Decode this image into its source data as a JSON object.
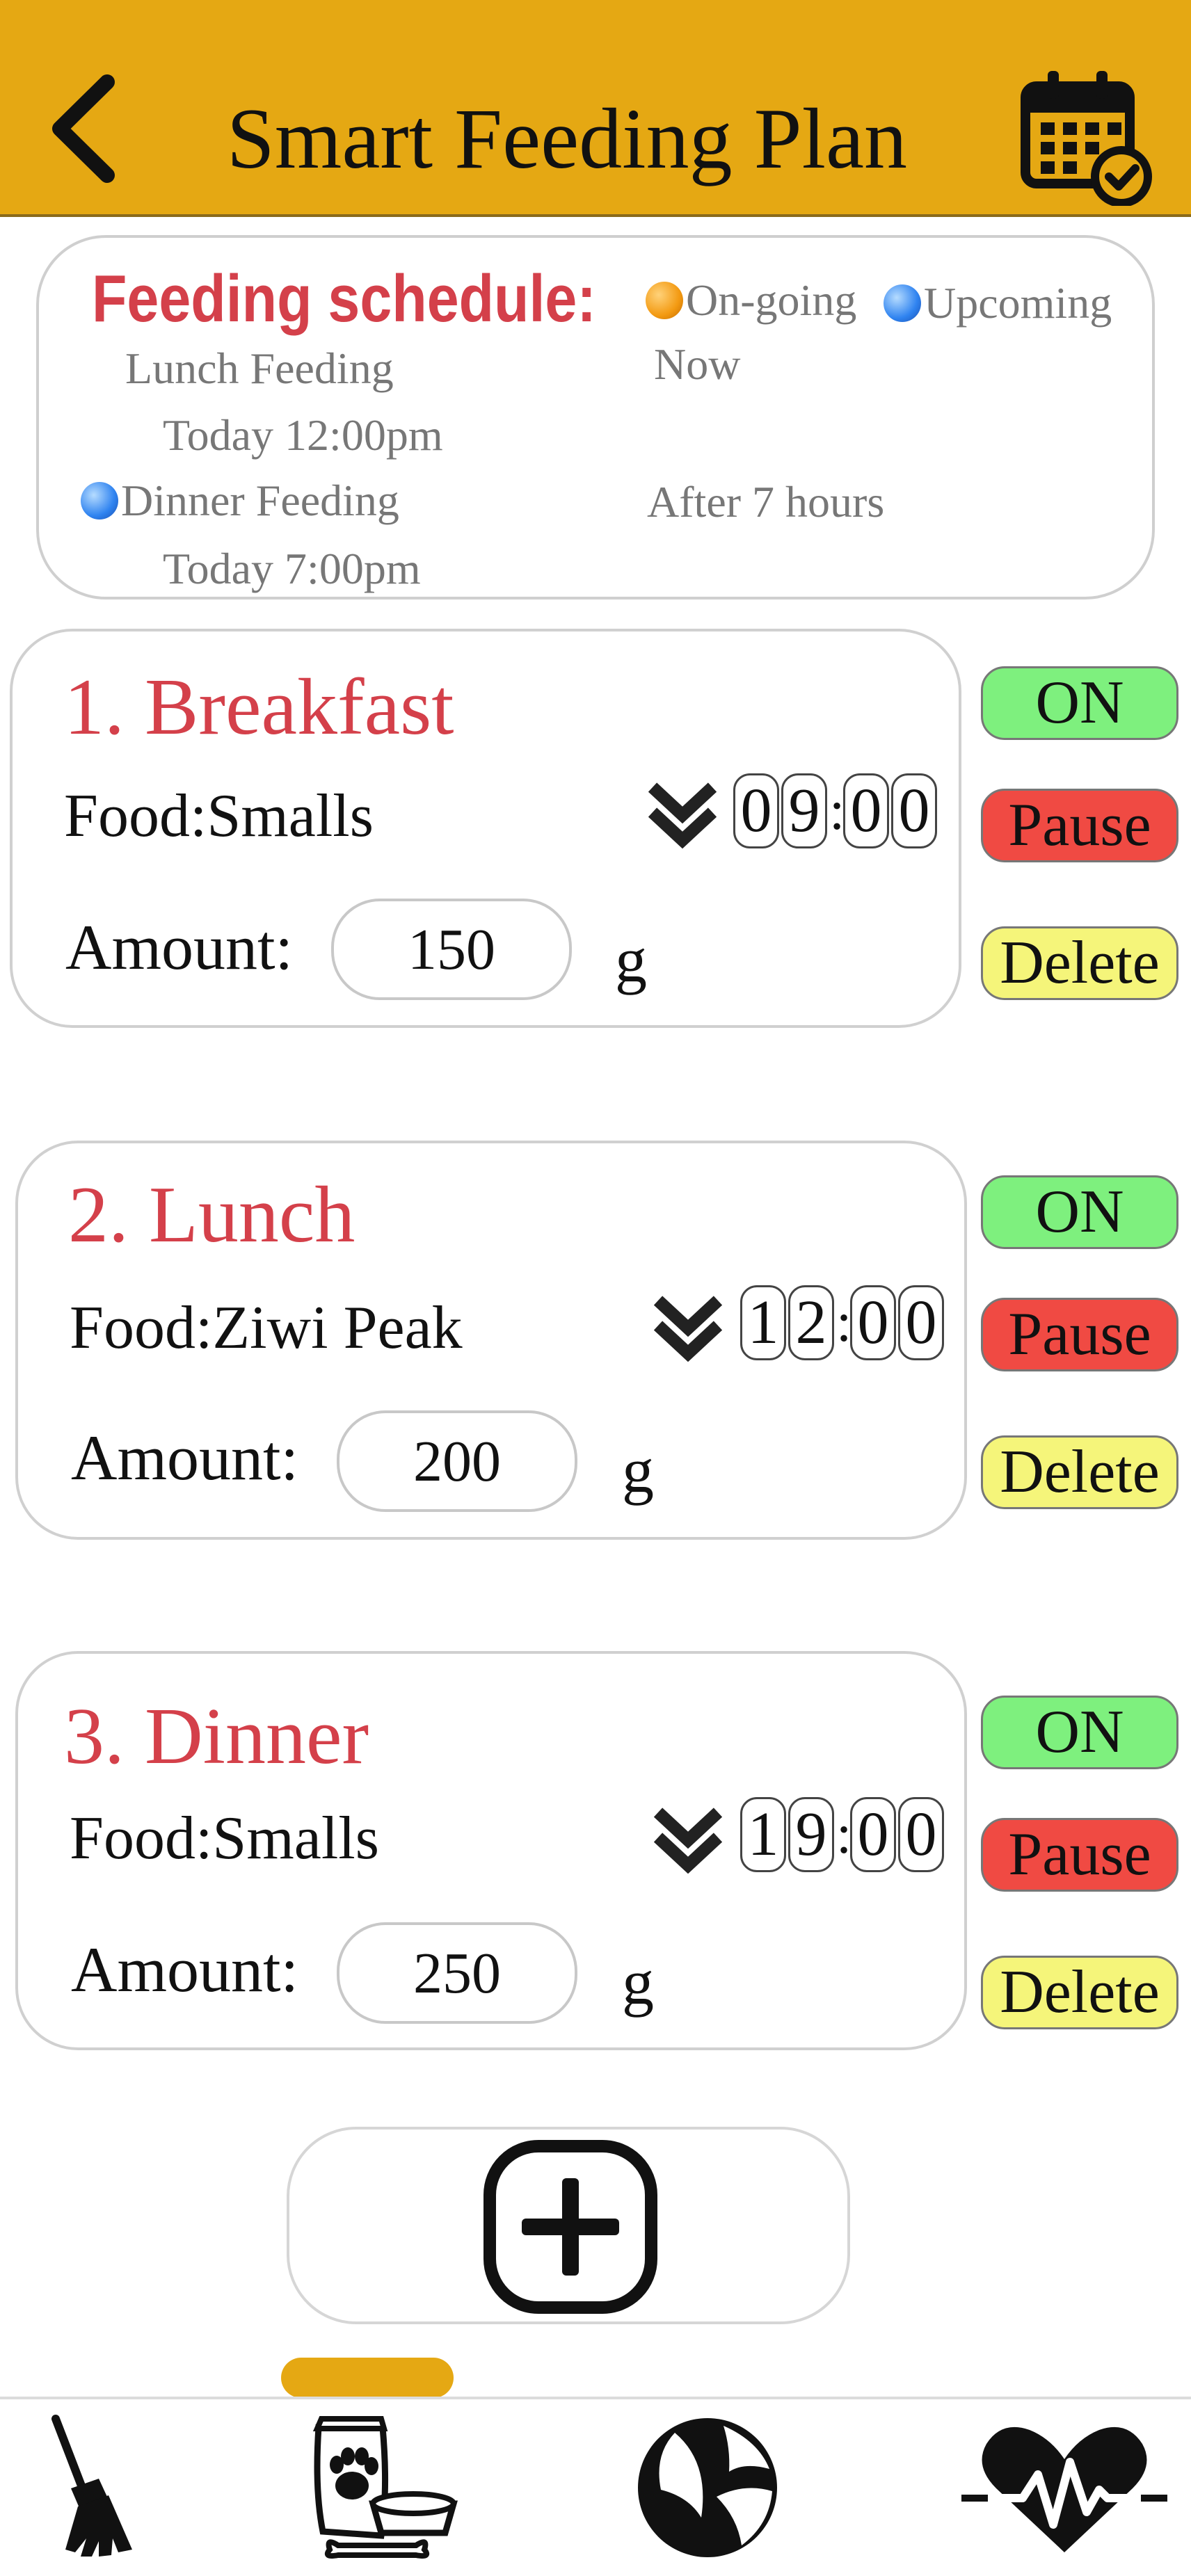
{
  "header": {
    "title": "Smart Feeding Plan",
    "back_icon": "chevron-left-icon",
    "calendar_icon": "calendar-check-icon",
    "background_color": "#e5a813"
  },
  "schedule": {
    "title": "Feeding schedule:",
    "legend": {
      "ongoing": "On-going",
      "upcoming": "Upcoming"
    },
    "items": [
      {
        "name": "Lunch Feeding",
        "time": "Today 12:00pm",
        "status": "Now"
      },
      {
        "name": "Dinner Feeding",
        "time": "Today 7:00pm",
        "status": "After 7 hours"
      }
    ]
  },
  "meals": [
    {
      "title": "1. Breakfast",
      "food": "Food:Smalls",
      "amount_label": "Amount:",
      "amount": "150",
      "unit": "g",
      "time_digits": [
        "0",
        "9",
        "0",
        "0"
      ],
      "buttons": {
        "on": "ON",
        "pause": "Pause",
        "delete": "Delete"
      }
    },
    {
      "title": "2. Lunch",
      "food": "Food:Ziwi Peak",
      "amount_label": "Amount:",
      "amount": "200",
      "unit": "g",
      "time_digits": [
        "1",
        "2",
        "0",
        "0"
      ],
      "buttons": {
        "on": "ON",
        "pause": "Pause",
        "delete": "Delete"
      }
    },
    {
      "title": "3. Dinner",
      "food": "Food:Smalls",
      "amount_label": "Amount:",
      "amount": "250",
      "unit": "g",
      "time_digits": [
        "1",
        "9",
        "0",
        "0"
      ],
      "buttons": {
        "on": "ON",
        "pause": "Pause",
        "delete": "Delete"
      }
    }
  ],
  "time_separator": ":",
  "add_button": {
    "icon": "plus-square-icon"
  },
  "bottom_nav": {
    "active_tab": "feeding",
    "tabs": [
      {
        "id": "cleaning",
        "icon": "broom-icon"
      },
      {
        "id": "feeding",
        "icon": "pet-food-icon"
      },
      {
        "id": "play",
        "icon": "ball-icon"
      },
      {
        "id": "health",
        "icon": "heartbeat-icon"
      }
    ]
  },
  "colors": {
    "accent": "#e5a813",
    "title_red": "#d4404a",
    "on_green": "#7ef07e",
    "pause_red": "#f04a43",
    "delete_yellow": "#f5f57a"
  }
}
